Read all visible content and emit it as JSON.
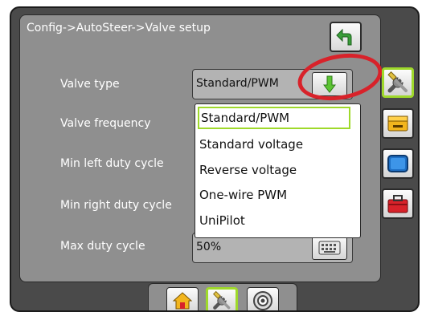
{
  "breadcrumb": "Config->AutoSteer->Valve setup",
  "icons": {
    "back": "back-arrow-icon",
    "dropdown": "down-arrow-icon",
    "keyboard": "keyboard-icon",
    "tools": "tools-icon",
    "console": "console-icon",
    "display": "display-icon",
    "toolbox": "toolbox-icon",
    "home": "home-icon",
    "steering": "steering-icon"
  },
  "rows": {
    "valve_type": {
      "label": "Valve type",
      "value": "Standard/PWM"
    },
    "valve_frequency": {
      "label": "Valve frequency"
    },
    "min_left": {
      "label": "Min left duty cycle"
    },
    "min_right": {
      "label": "Min right duty cycle"
    },
    "max_duty": {
      "label": "Max duty cycle",
      "value": "50%"
    }
  },
  "dropdown": {
    "options": [
      "Standard/PWM",
      "Standard voltage",
      "Reverse voltage",
      "One-wire PWM",
      "UniPilot"
    ],
    "selected": "Standard/PWM"
  },
  "colors": {
    "accent": "#9fd92b",
    "highlight": "#d8222a",
    "panel": "#8f8f8f",
    "frame": "#4a4a4a"
  }
}
